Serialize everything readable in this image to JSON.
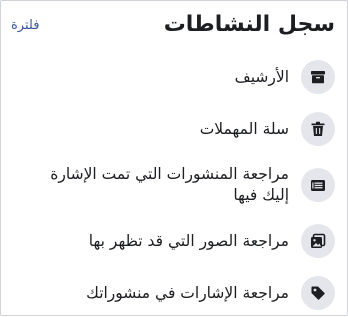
{
  "header": {
    "title": "سجل النشاطات",
    "filter_label": "فلترة"
  },
  "menu": {
    "items": [
      {
        "label": "الأرشيف",
        "icon": "archive-icon"
      },
      {
        "label": "سلة المهملات",
        "icon": "trash-icon"
      },
      {
        "label": "مراجعة المنشورات التي تمت الإشارة إليك فيها",
        "icon": "tagged-posts-icon"
      },
      {
        "label": "مراجعة الصور التي قد تظهر بها",
        "icon": "photos-icon"
      },
      {
        "label": "مراجعة الإشارات في منشوراتك",
        "icon": "tag-icon"
      }
    ]
  },
  "colors": {
    "title": "#1c1e21",
    "link": "#385898",
    "icon_bg": "#e4e6eb",
    "icon_fg": "#1c1e21",
    "border": "#d0d3d8"
  }
}
